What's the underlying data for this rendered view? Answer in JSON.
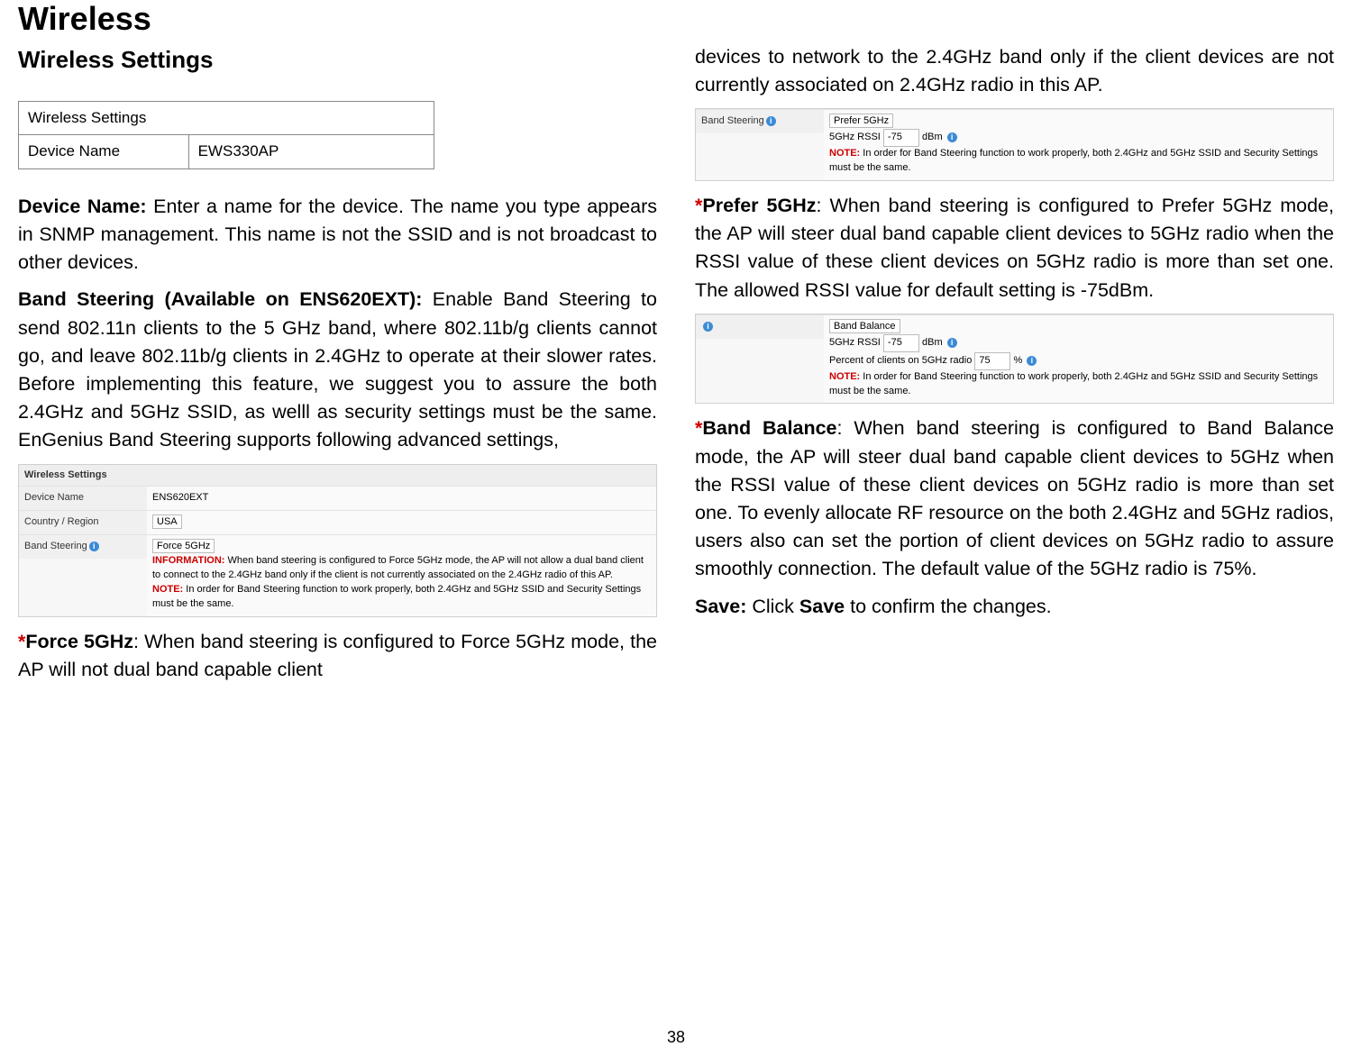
{
  "page": {
    "title": "Wireless",
    "subtitle": "Wireless Settings",
    "number": "38"
  },
  "left": {
    "settings_box": {
      "header": "Wireless Settings",
      "label": "Device Name",
      "value": "EWS330AP"
    },
    "device_name_heading": "Device Name:",
    "device_name_body": " Enter a name for the device. The name you type appears in SNMP management. This name is not the SSID and is not broadcast to other devices.",
    "band_steering_heading": "Band Steering (Available on ENS620EXT):",
    "band_steering_body": " Enable Band Steering to send 802.11n clients to the 5 GHz band, where 802.11b/g clients cannot go, and leave 802.11b/g clients in 2.4GHz to operate at their slower rates. Before implementing this feature, we suggest you to assure the both 2.4GHz and 5GHz SSID, as welll as security settings must be the same. EnGenius Band Steering supports following advanced settings,",
    "panel1": {
      "title": "Wireless Settings",
      "row1_label": "Device Name",
      "row1_value": "ENS620EXT",
      "row2_label": "Country / Region",
      "row2_value": "USA",
      "row3_label": "Band Steering",
      "row3_select": "Force 5GHz",
      "info_label": "INFORMATION:",
      "info_text": "   When band steering is configured to Force 5GHz mode, the AP will not allow a dual band client to connect to the 2.4GHz band only if the client is not currently associated on the 2.4GHz radio of this AP.",
      "note_label": "NOTE:",
      "note_text": "   In order for Band Steering function to work properly, both 2.4GHz and 5GHz SSID and Security Settings must be the same."
    },
    "force5_star": "*",
    "force5_heading": "Force 5GHz",
    "force5_body": ": When band steering is configured to Force 5GHz mode, the AP will not dual band capable client"
  },
  "right": {
    "continuation": "devices to network to the 2.4GHz band only if the client devices are not currently associated on 2.4GHz radio in this AP.",
    "panel2": {
      "row_label": "Band Steering",
      "select": "Prefer 5GHz",
      "rssi_label": "5GHz RSSI",
      "rssi_value": "-75",
      "rssi_unit": "dBm",
      "note_label": "NOTE:",
      "note_text": "   In order for Band Steering function to work properly, both 2.4GHz and 5GHz SSID and Security Settings must be the same."
    },
    "prefer5_star": " *",
    "prefer5_heading": "Prefer 5GHz",
    "prefer5_body": ": When band steering is configured to Prefer 5GHz  mode, the AP will steer dual band capable client devices to 5GHz radio when the RSSI value of these client devices on 5GHz radio is more than set one. The allowed RSSI value for default setting is -75dBm.",
    "panel3": {
      "select": "Band Balance",
      "rssi_label": "5GHz RSSI",
      "rssi_value": "-75",
      "rssi_unit": "dBm",
      "pct_label": "Percent of clients on 5GHz radio",
      "pct_value": "75",
      "pct_unit": "%",
      "note_label": "NOTE:",
      "note_text": "   In order for Band Steering function to work properly, both 2.4GHz and 5GHz SSID and Security Settings must be the same."
    },
    "balance_star": "  *",
    "balance_heading": "Band Balance",
    "balance_body": ": When band steering is configured to Band Balance mode, the AP will steer dual band capable client devices to 5GHz when the RSSI value of these client devices on 5GHz radio is more than set one. To evenly allocate RF resource on the both 2.4GHz and 5GHz radios, users also can set the portion of client devices on 5GHz radio to assure smoothly connection. The default value of the 5GHz radio is 75%.",
    "save_heading": "Save:",
    "save_body_1": " Click ",
    "save_bold": "Save",
    "save_body_2": " to confirm the changes."
  }
}
